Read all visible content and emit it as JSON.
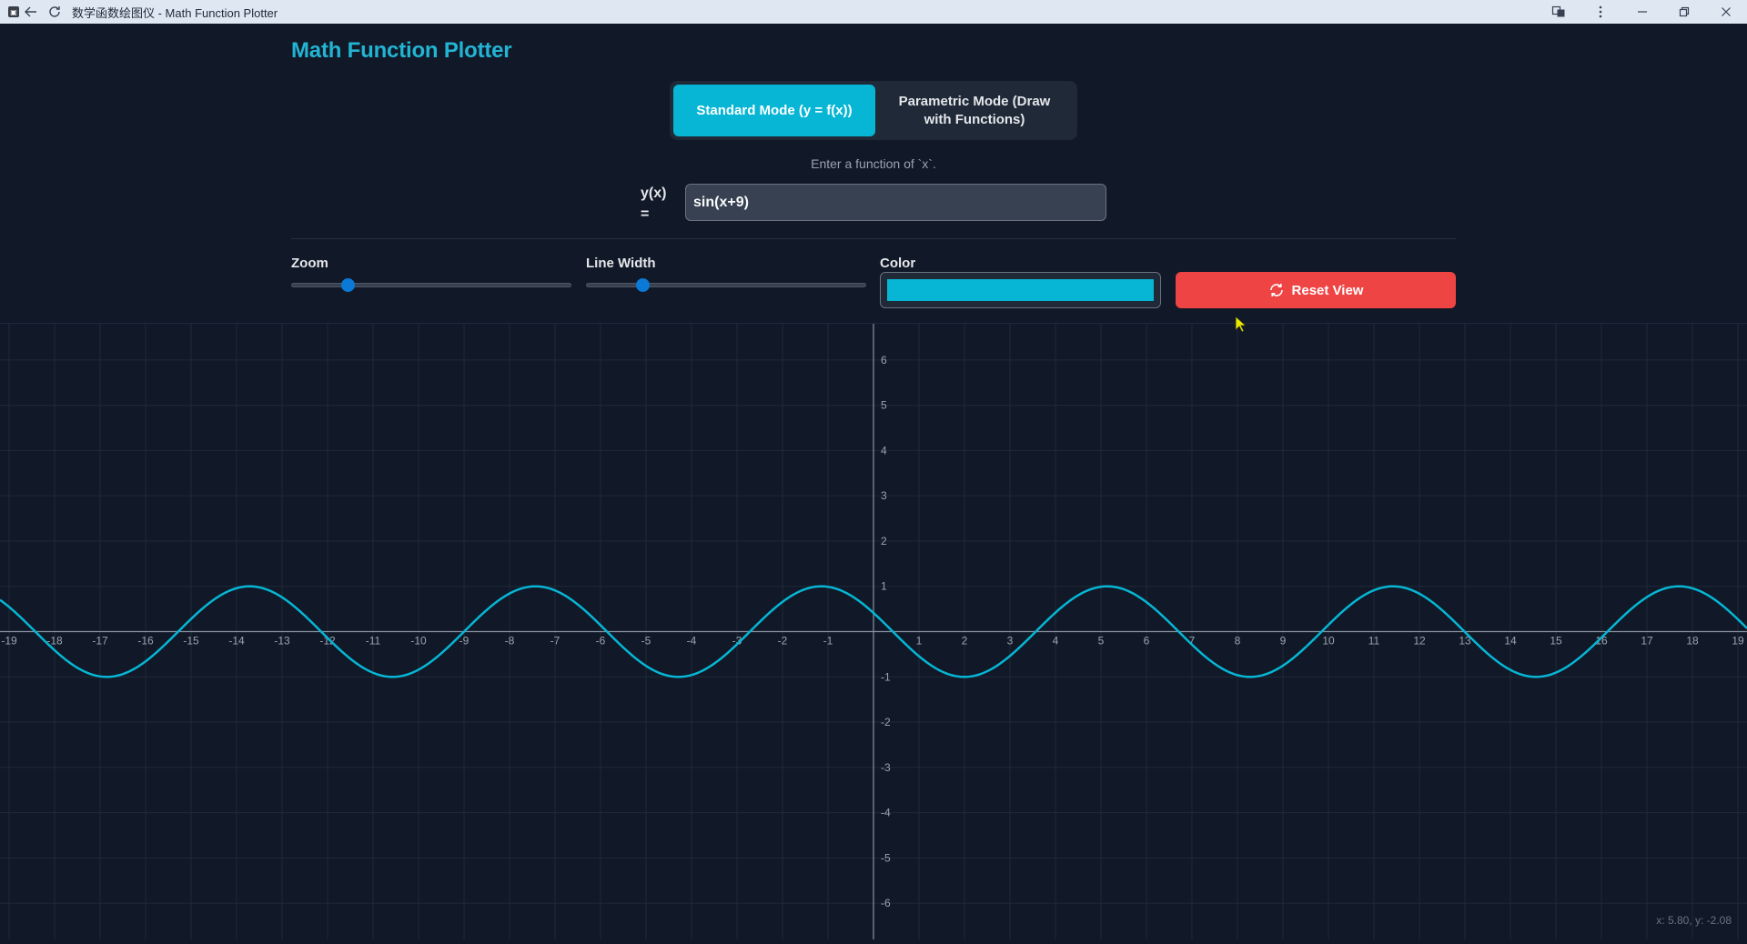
{
  "window": {
    "title": "数学函数绘图仪 - Math Function Plotter",
    "app_icon_glyph": "▣"
  },
  "app": {
    "title": "Math Function Plotter"
  },
  "modes": {
    "standard_label": "Standard Mode (y = f(x))",
    "parametric_label": "Parametric Mode (Draw with Functions)",
    "active": "standard"
  },
  "function": {
    "hint": "Enter a function of `x`.",
    "label": "y(x) =",
    "value": "sin(x+9)"
  },
  "controls": {
    "zoom_label": "Zoom",
    "zoom_fraction": 0.2,
    "line_width_label": "Line Width",
    "line_width_fraction": 0.2,
    "color_label": "Color",
    "color_value": "#06b6d4",
    "reset_label": "Reset View"
  },
  "colors": {
    "accent": "#06b6d4",
    "reset": "#ef4444",
    "background": "#111827"
  },
  "status": {
    "coord_readout": "x: 5.80, y: -2.08"
  },
  "chart_data": {
    "type": "line",
    "expression": "sin(x+9)",
    "xlim": [
      -19.2,
      19.2
    ],
    "ylim": [
      -6.8,
      6.8
    ],
    "x_ticks": [
      -19,
      -18,
      -17,
      -16,
      -15,
      -14,
      -13,
      -12,
      -11,
      -10,
      -9,
      -8,
      -7,
      -6,
      -5,
      -4,
      -3,
      -2,
      -1,
      1,
      2,
      3,
      4,
      5,
      6,
      7,
      8,
      9,
      10,
      11,
      12,
      13,
      14,
      15,
      16,
      17,
      18,
      19
    ],
    "y_ticks": [
      -6,
      -5,
      -4,
      -3,
      -2,
      -1,
      1,
      2,
      3,
      4,
      5,
      6
    ],
    "grid": true,
    "series": [
      {
        "color": "#06b6d4"
      }
    ]
  }
}
